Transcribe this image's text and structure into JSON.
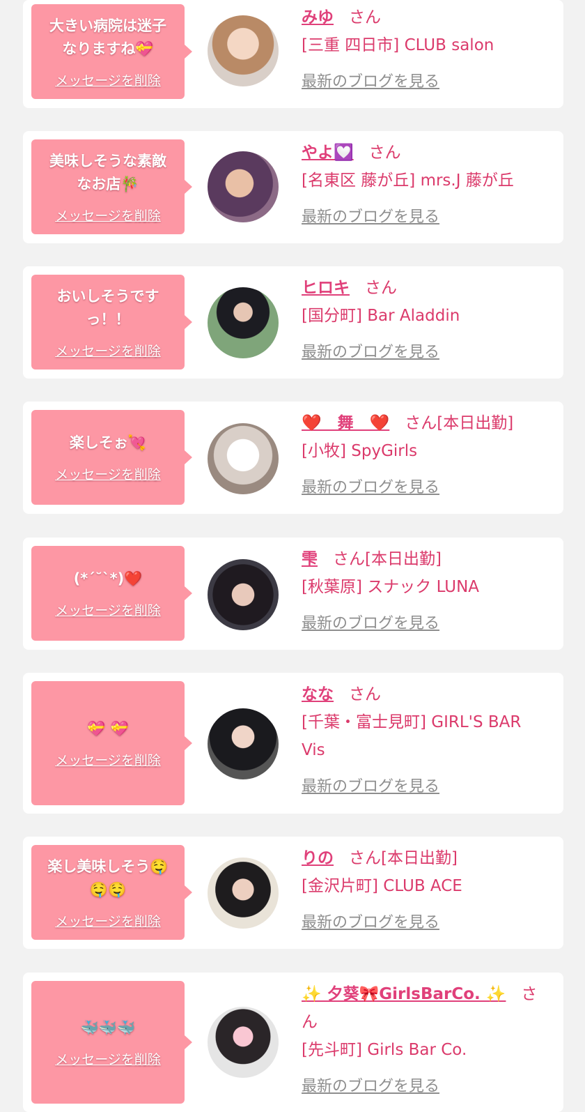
{
  "common": {
    "delete_label": "メッセージを削除",
    "blog_label": "最新のブログを見る",
    "san": "さん"
  },
  "colors": {
    "bubble": "#fd97a4",
    "accent_pink": "#e0407a",
    "shop_text": "#db3a6b",
    "link_gray": "#8e8e8e",
    "background": "#f2f2f2"
  },
  "items": [
    {
      "message": "大きい病院は迷子\nなりますね💝",
      "name": "みゆ",
      "suffix": "さん",
      "shop": "[三重 四日市] CLUB salon",
      "avatar_icon": "avatar-photo"
    },
    {
      "message": "美味しそうな素敵\nなお店🎋",
      "name": "やよ💟",
      "suffix": "さん",
      "shop": "[名東区 藤が丘] mrs.J 藤が丘",
      "avatar_icon": "avatar-photo"
    },
    {
      "message": "おいしそうです\nっ！！",
      "name": "ヒロキ",
      "suffix": "さん",
      "shop": "[国分町] Bar Aladdin",
      "avatar_icon": "avatar-photo"
    },
    {
      "message": "楽しそぉ💘",
      "name": "❤️　舞　❤️",
      "suffix": "さん[本日出勤]",
      "shop": "[小牧] SpyGirls",
      "avatar_icon": "avatar-photo"
    },
    {
      "message": "(*´˘`*)❤️",
      "name": "雫",
      "suffix": "さん[本日出勤]",
      "shop": "[秋葉原] スナック LUNA",
      "avatar_icon": "avatar-photo"
    },
    {
      "message": "💝 💝",
      "name": "なな",
      "suffix": "さん",
      "shop": "[千葉・富士見町] GIRL'S BAR Vis",
      "avatar_icon": "avatar-photo"
    },
    {
      "message": "楽し美味しそう🤤\n🤤🤤",
      "name": "りの",
      "suffix": "さん[本日出勤]",
      "shop": "[金沢片町] CLUB ACE",
      "avatar_icon": "avatar-photo"
    },
    {
      "message": "🐳🐳🐳",
      "name": "✨ 夕葵🎀GirlsBarCo. ✨",
      "suffix": "さん",
      "shop": "[先斗町] Girls Bar Co.",
      "avatar_icon": "avatar-photo"
    }
  ]
}
